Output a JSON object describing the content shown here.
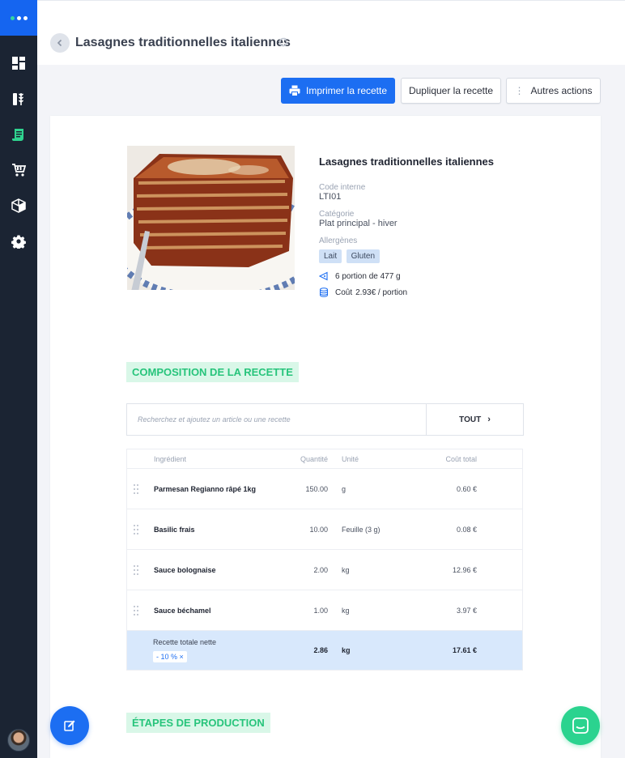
{
  "header": {
    "title": "Lasagnes traditionnelles italiennes"
  },
  "actions": {
    "print_label": "Imprimer la recette",
    "duplicate_label": "Dupliquer la recette",
    "more_label": "Autres actions"
  },
  "sidebar": {
    "items": [
      {
        "icon": "dashboard-icon"
      },
      {
        "icon": "ingredients-icon"
      },
      {
        "icon": "recipes-icon",
        "active": true
      },
      {
        "icon": "cart-icon"
      },
      {
        "icon": "box-icon"
      },
      {
        "icon": "gear-icon"
      }
    ]
  },
  "recipe": {
    "name": "Lasagnes traditionnelles italiennes",
    "code_label": "Code interne",
    "code": "LTI01",
    "category_label": "Catégorie",
    "category": "Plat principal - hiver",
    "allergens_label": "Allergènes",
    "allergens": [
      "Lait",
      "Gluten"
    ],
    "portions": "6 portion de 477 g",
    "cost_label": "Coût",
    "cost": "2.93€ / portion"
  },
  "composition": {
    "title": "COMPOSITION DE LA RECETTE",
    "search_placeholder": "Recherchez et ajoutez un article ou une recette",
    "filter_label": "TOUT",
    "columns": {
      "ingredient": "Ingrédient",
      "quantity": "Quantité",
      "unit": "Unité",
      "cost": "Coût total"
    },
    "rows": [
      {
        "ingredient": "Parmesan Regianno râpé 1kg",
        "quantity": "150.00",
        "unit": "g",
        "cost": "0.60 €"
      },
      {
        "ingredient": "Basilic frais",
        "quantity": "10.00",
        "unit": "Feuille (3 g)",
        "cost": "0.08 €"
      },
      {
        "ingredient": "Sauce bolognaise",
        "quantity": "2.00",
        "unit": "kg",
        "cost": "12.96 €"
      },
      {
        "ingredient": "Sauce béchamel",
        "quantity": "1.00",
        "unit": "kg",
        "cost": "3.97 €"
      }
    ],
    "total": {
      "label": "Recette totale nette",
      "discount": "- 10 %  ×",
      "quantity": "2.86",
      "unit": "kg",
      "cost": "17.61 €"
    }
  },
  "production": {
    "title": "ÉTAPES DE PRODUCTION"
  },
  "colors": {
    "primary": "#1c6ef2",
    "accent_green": "#2bd38f",
    "sidebar": "#1b2433"
  }
}
